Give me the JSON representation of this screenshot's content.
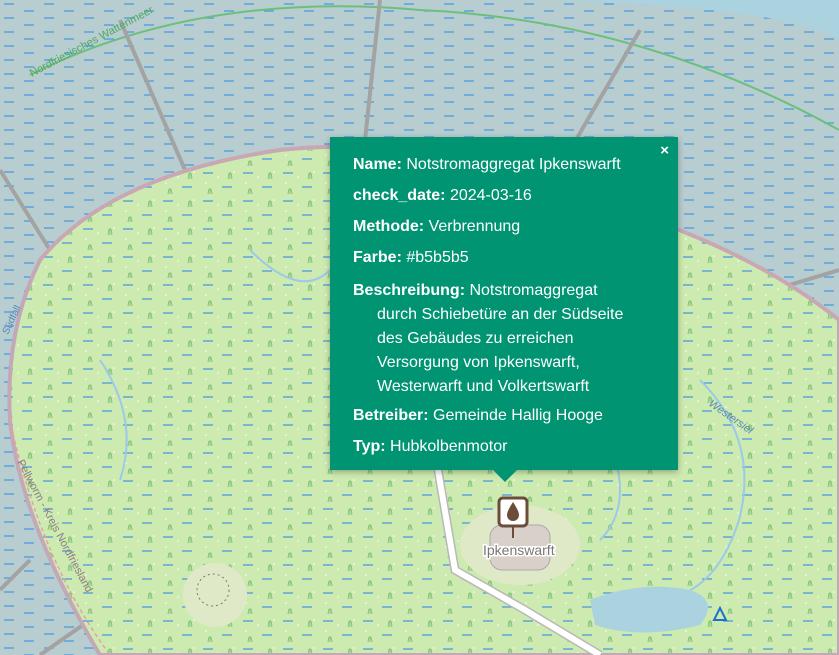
{
  "map": {
    "labels": {
      "wadden": "Nordfriesisches Wattenmeer",
      "border": "Pellworm - Kreis Nordfriesland",
      "creek": "Westersiel",
      "place": "Ipkenswarft",
      "left_edge": "Südfall"
    },
    "colors": {
      "water": "#b8cfd2",
      "land": "#cdebb0",
      "popup": "#009473"
    }
  },
  "popup": {
    "close_label": "×",
    "fields": [
      {
        "key": "Name:",
        "value": "Notstromaggregat Ipkenswarft"
      },
      {
        "key": "check_date:",
        "value": "2024-03-16"
      },
      {
        "key": "Methode:",
        "value": "Verbrennung"
      },
      {
        "key": "Farbe:",
        "value": "#b5b5b5"
      }
    ],
    "description": {
      "key": "Beschreibung:",
      "first": "Notstromaggregat",
      "lines": [
        "durch Schiebetüre an der Südseite",
        "des Gebäudes zu erreichen",
        "Versorgung von Ipkenswarft,",
        "Westerwarft und Volkertswarft"
      ]
    },
    "fields2": [
      {
        "key": "Betreiber:",
        "value": "Gemeinde Hallig Hooge"
      },
      {
        "key": "Typ:",
        "value": "Hubkolbenmotor"
      }
    ]
  }
}
